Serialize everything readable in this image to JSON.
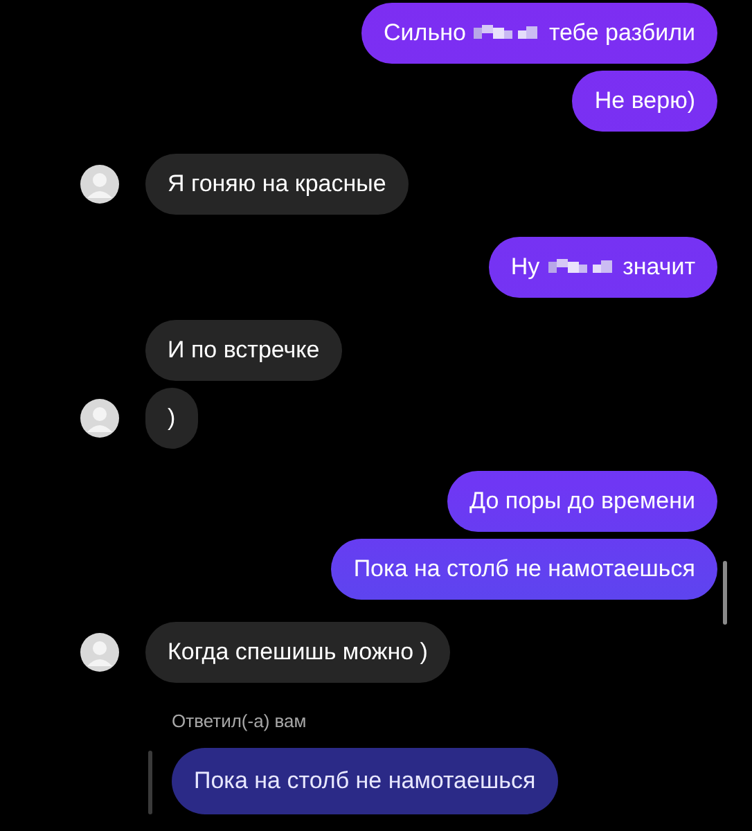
{
  "messages": [
    {
      "kind": "sent",
      "parts": [
        {
          "kind": "text",
          "text": "Сильно"
        },
        {
          "kind": "censored"
        },
        {
          "kind": "text",
          "text": "тебе разбили"
        }
      ]
    },
    {
      "kind": "sent",
      "parts": [
        {
          "kind": "text",
          "text": "Не верю)"
        }
      ]
    },
    {
      "kind": "received",
      "avatar": true,
      "parts": [
        {
          "kind": "text",
          "text": "Я гоняю на красные"
        }
      ]
    },
    {
      "kind": "sent",
      "parts": [
        {
          "kind": "text",
          "text": "Ну"
        },
        {
          "kind": "censored"
        },
        {
          "kind": "text",
          "text": "значит"
        }
      ]
    },
    {
      "kind": "received",
      "avatar": false,
      "parts": [
        {
          "kind": "text",
          "text": "И по встречке"
        }
      ]
    },
    {
      "kind": "received",
      "avatar": true,
      "parts": [
        {
          "kind": "text",
          "text": ")"
        }
      ]
    },
    {
      "kind": "sent",
      "parts": [
        {
          "kind": "text",
          "text": "До поры до времени"
        }
      ]
    },
    {
      "kind": "sent",
      "parts": [
        {
          "kind": "text",
          "text": "Пока на столб не намотаешься"
        }
      ]
    },
    {
      "kind": "received",
      "avatar": true,
      "parts": [
        {
          "kind": "text",
          "text": "Когда спешишь можно )"
        }
      ]
    }
  ],
  "reply": {
    "label": "Ответил(-а) вам",
    "quote": "Пока на столб не намотаешься"
  }
}
